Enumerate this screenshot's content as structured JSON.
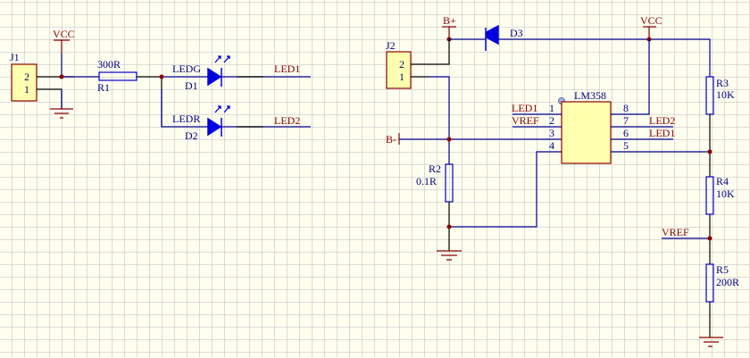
{
  "colors": {
    "background": "#fffff0",
    "grid": "#c8c8c8",
    "wire": "#00008b",
    "net_label": "#8b0000",
    "designator": "#000080",
    "component_fill": "#ffffb0"
  },
  "power": {
    "vcc_left": "VCC",
    "vcc_right": "VCC",
    "b_plus": "B+",
    "b_minus": "B-"
  },
  "connectors": [
    {
      "designator": "J1",
      "pins": [
        "2",
        "1"
      ]
    },
    {
      "designator": "J2",
      "pins": [
        "2",
        "1"
      ]
    }
  ],
  "resistors": [
    {
      "designator": "R1",
      "value": "300R"
    },
    {
      "designator": "R2",
      "value": "0.1R"
    },
    {
      "designator": "R3",
      "value": "10K"
    },
    {
      "designator": "R4",
      "value": "10K"
    },
    {
      "designator": "R5",
      "value": "200R"
    }
  ],
  "diodes": [
    {
      "designator": "D1",
      "label": "LEDG",
      "net": "LED1"
    },
    {
      "designator": "D2",
      "label": "LEDR",
      "net": "LED2"
    },
    {
      "designator": "D3"
    }
  ],
  "ic": {
    "name": "LM358",
    "left_pins": [
      {
        "num": "1",
        "net": "LED1"
      },
      {
        "num": "2",
        "net": "VREF"
      },
      {
        "num": "3"
      },
      {
        "num": "4"
      }
    ],
    "right_pins": [
      {
        "num": "8"
      },
      {
        "num": "7",
        "net": "LED2"
      },
      {
        "num": "6",
        "net": "LED1"
      },
      {
        "num": "5"
      }
    ]
  },
  "vref_label": "VREF"
}
